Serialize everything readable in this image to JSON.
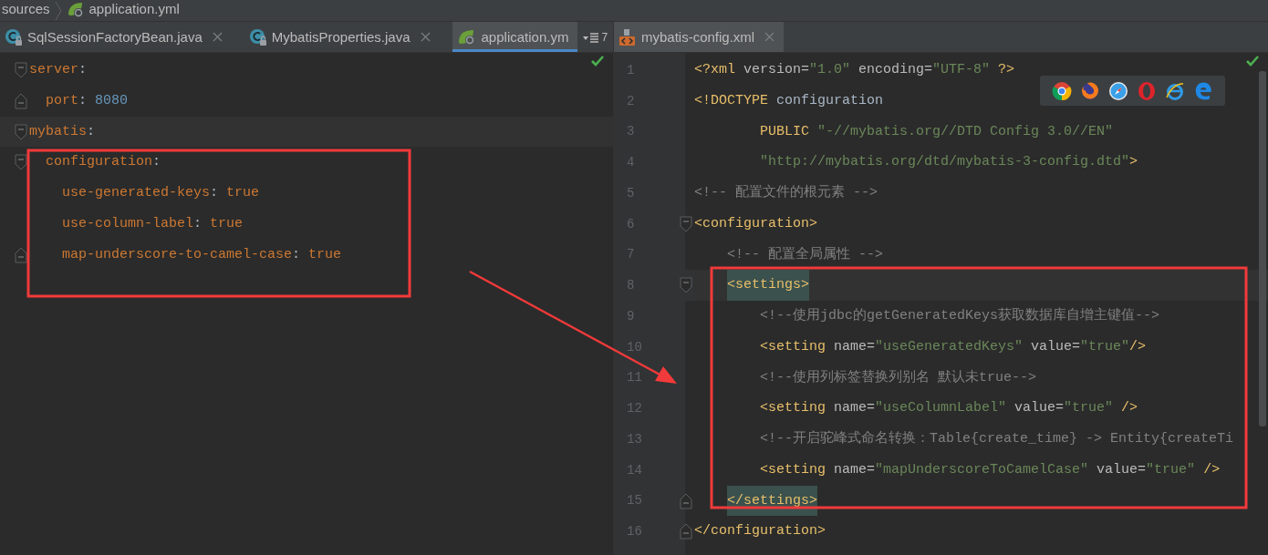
{
  "breadcrumb": [
    {
      "label": "sources",
      "kind": "folder"
    },
    {
      "label": "application.yml",
      "kind": "spring-file"
    }
  ],
  "panes": [
    {
      "focused": true,
      "overflow": {
        "count": "7"
      },
      "tabs": [
        {
          "label": "SqlSessionFactoryBean.java",
          "kind": "class",
          "selected": false,
          "closable": true
        },
        {
          "label": "MybatisProperties.java",
          "kind": "class",
          "selected": false,
          "closable": true
        },
        {
          "label": "application.ym",
          "kind": "spring",
          "selected": true,
          "closable": false
        }
      ],
      "lines": [
        {
          "fold_start": true,
          "tokens": [
            {
              "kind": "key",
              "text": "server"
            },
            {
              "kind": "plain",
              "text": ":"
            }
          ]
        },
        {
          "fold_end": true,
          "tokens": [
            {
              "kind": "key",
              "text": "  port"
            },
            {
              "kind": "plain",
              "text": ": "
            },
            {
              "kind": "number",
              "text": "8080"
            }
          ]
        },
        {
          "fold_start": true,
          "current": true,
          "tokens": [
            {
              "kind": "key",
              "text": "mybatis"
            },
            {
              "kind": "plain",
              "text": ":"
            }
          ]
        },
        {
          "fold_start": true,
          "tokens": [
            {
              "kind": "key",
              "text": "  configuration"
            },
            {
              "kind": "plain",
              "text": ":"
            }
          ]
        },
        {
          "tokens": [
            {
              "kind": "key",
              "text": "    use-generated-keys"
            },
            {
              "kind": "plain",
              "text": ": "
            },
            {
              "kind": "key",
              "text": "true"
            }
          ]
        },
        {
          "tokens": [
            {
              "kind": "key",
              "text": "    use-column-label"
            },
            {
              "kind": "plain",
              "text": ": "
            },
            {
              "kind": "key",
              "text": "true"
            }
          ]
        },
        {
          "fold_end": true,
          "tokens": [
            {
              "kind": "key",
              "text": "    map-underscore-to-camel-case"
            },
            {
              "kind": "plain",
              "text": ": "
            },
            {
              "kind": "key",
              "text": "true"
            }
          ]
        }
      ]
    },
    {
      "tabs": [
        {
          "label": "mybatis-config.xml",
          "kind": "xml",
          "selected": true,
          "closable": true
        }
      ],
      "browsers": [
        {
          "kind": "chrome"
        },
        {
          "kind": "firefox"
        },
        {
          "kind": "safari"
        },
        {
          "kind": "opera"
        },
        {
          "kind": "ie"
        },
        {
          "kind": "edge"
        }
      ],
      "lines": [
        {
          "number": "1",
          "tokens": [
            {
              "kind": "tag",
              "text": "<?xml"
            },
            {
              "kind": "attr",
              "text": " version="
            },
            {
              "kind": "string",
              "text": "\"1.0\""
            },
            {
              "kind": "attr",
              "text": " encoding="
            },
            {
              "kind": "string",
              "text": "\"UTF-8\""
            },
            {
              "kind": "tag",
              "text": " ?>"
            }
          ]
        },
        {
          "number": "2",
          "tokens": [
            {
              "kind": "tag",
              "text": "<!DOCTYPE"
            },
            {
              "kind": "plain",
              "text": " configuration"
            }
          ]
        },
        {
          "number": "3",
          "tokens": [
            {
              "kind": "tag",
              "text": "        PUBLIC "
            },
            {
              "kind": "string",
              "text": "\"-//mybatis.org//DTD Config 3.0//EN\""
            }
          ]
        },
        {
          "number": "4",
          "tokens": [
            {
              "kind": "string",
              "text": "        \"http://mybatis.org/dtd/mybatis-3-config.dtd\""
            },
            {
              "kind": "tag",
              "text": ">"
            }
          ]
        },
        {
          "number": "5",
          "tokens": [
            {
              "kind": "comment",
              "text": "<!-- 配置文件的根元素 -->"
            }
          ]
        },
        {
          "number": "6",
          "fold_start": true,
          "tokens": [
            {
              "kind": "tag",
              "text": "<configuration>"
            }
          ]
        },
        {
          "number": "7",
          "tokens": [
            {
              "kind": "comment",
              "text": "    <!-- 配置全局属性 -->"
            }
          ]
        },
        {
          "number": "8",
          "fold_start": true,
          "current": true,
          "tokens": [
            {
              "kind": "tag",
              "text": "    <settings>",
              "matched": true
            }
          ]
        },
        {
          "number": "9",
          "tokens": [
            {
              "kind": "comment",
              "text": "        <!--使用jdbc的getGeneratedKeys获取数据库自增主键值-->"
            }
          ]
        },
        {
          "number": "10",
          "tokens": [
            {
              "kind": "tag",
              "text": "        <setting"
            },
            {
              "kind": "attr",
              "text": " name="
            },
            {
              "kind": "string",
              "text": "\"useGeneratedKeys\""
            },
            {
              "kind": "attr",
              "text": " value="
            },
            {
              "kind": "string",
              "text": "\"true\""
            },
            {
              "kind": "tag",
              "text": "/>"
            }
          ]
        },
        {
          "number": "11",
          "tokens": [
            {
              "kind": "comment",
              "text": "        <!--使用列标签替换列别名 默认未true-->"
            }
          ]
        },
        {
          "number": "12",
          "tokens": [
            {
              "kind": "tag",
              "text": "        <setting"
            },
            {
              "kind": "attr",
              "text": " name="
            },
            {
              "kind": "string",
              "text": "\"useColumnLabel\""
            },
            {
              "kind": "attr",
              "text": " value="
            },
            {
              "kind": "string",
              "text": "\"true\""
            },
            {
              "kind": "tag",
              "text": " />"
            }
          ]
        },
        {
          "number": "13",
          "tokens": [
            {
              "kind": "comment",
              "text": "        <!--开启驼峰式命名转换：Table{create_time} -> Entity{createTi"
            }
          ]
        },
        {
          "number": "14",
          "tokens": [
            {
              "kind": "tag",
              "text": "        <setting"
            },
            {
              "kind": "attr",
              "text": " name="
            },
            {
              "kind": "string",
              "text": "\"mapUnderscoreToCamelCase\""
            },
            {
              "kind": "attr",
              "text": " value="
            },
            {
              "kind": "string",
              "text": "\"true\""
            },
            {
              "kind": "tag",
              "text": " />"
            }
          ]
        },
        {
          "number": "15",
          "fold_end": true,
          "tokens": [
            {
              "kind": "tag",
              "text": "    </settings>",
              "matched": true
            }
          ]
        },
        {
          "number": "16",
          "fold_end": true,
          "tokens": [
            {
              "kind": "tag",
              "text": "</configuration>"
            }
          ]
        }
      ]
    }
  ]
}
